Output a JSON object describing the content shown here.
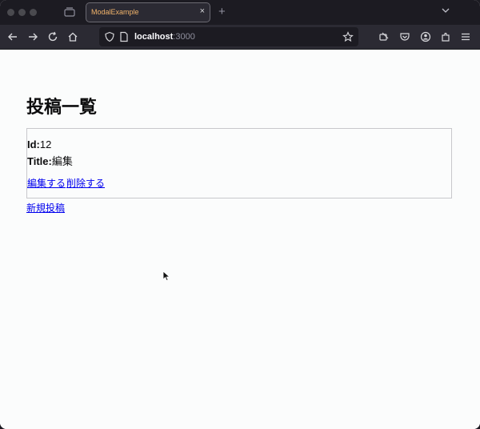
{
  "browser": {
    "tab_title": "ModalExample",
    "tab_close": "×",
    "new_tab": "+",
    "url_host": "localhost",
    "url_port": ":3000"
  },
  "page": {
    "title": "投稿一覧",
    "posts": [
      {
        "id_label": "Id:",
        "id_value": "12",
        "title_label": "Title:",
        "title_value": "編集",
        "edit_label": "編集する",
        "delete_label": "削除する"
      }
    ],
    "new_post_label": "新規投稿"
  },
  "colors": {
    "link": "#0000ee",
    "tab_title": "#f2b46b",
    "chrome_bg": "#1c1b22",
    "page_bg": "#fbfcfc"
  }
}
